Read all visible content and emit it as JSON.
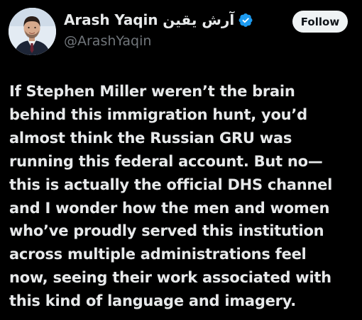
{
  "author": {
    "display_name": "Arash Yaqin آرش یقین",
    "handle": "@ArashYaqin",
    "verified": true,
    "avatar_icon": "profile-photo"
  },
  "follow_button": {
    "label": "Follow"
  },
  "tweet": {
    "lines": [
      "If Stephen Miller weren’t the brain",
      "behind this immigration hunt, you’d",
      "almost think the Russian GRU was",
      "running this federal account. But no—",
      "this is actually the official DHS channel",
      "and I wonder how the men and women",
      "who’ve proudly served this institution",
      "across multiple administrations feel",
      "now, seeing their work associated with",
      "this kind of language and imagery."
    ]
  },
  "colors": {
    "background": "#000000",
    "text_primary": "#e7e9ea",
    "text_secondary": "#71767b",
    "verified_badge": "#1d9bf0",
    "follow_button_bg": "#eff3f4",
    "follow_button_text": "#0f1419"
  }
}
